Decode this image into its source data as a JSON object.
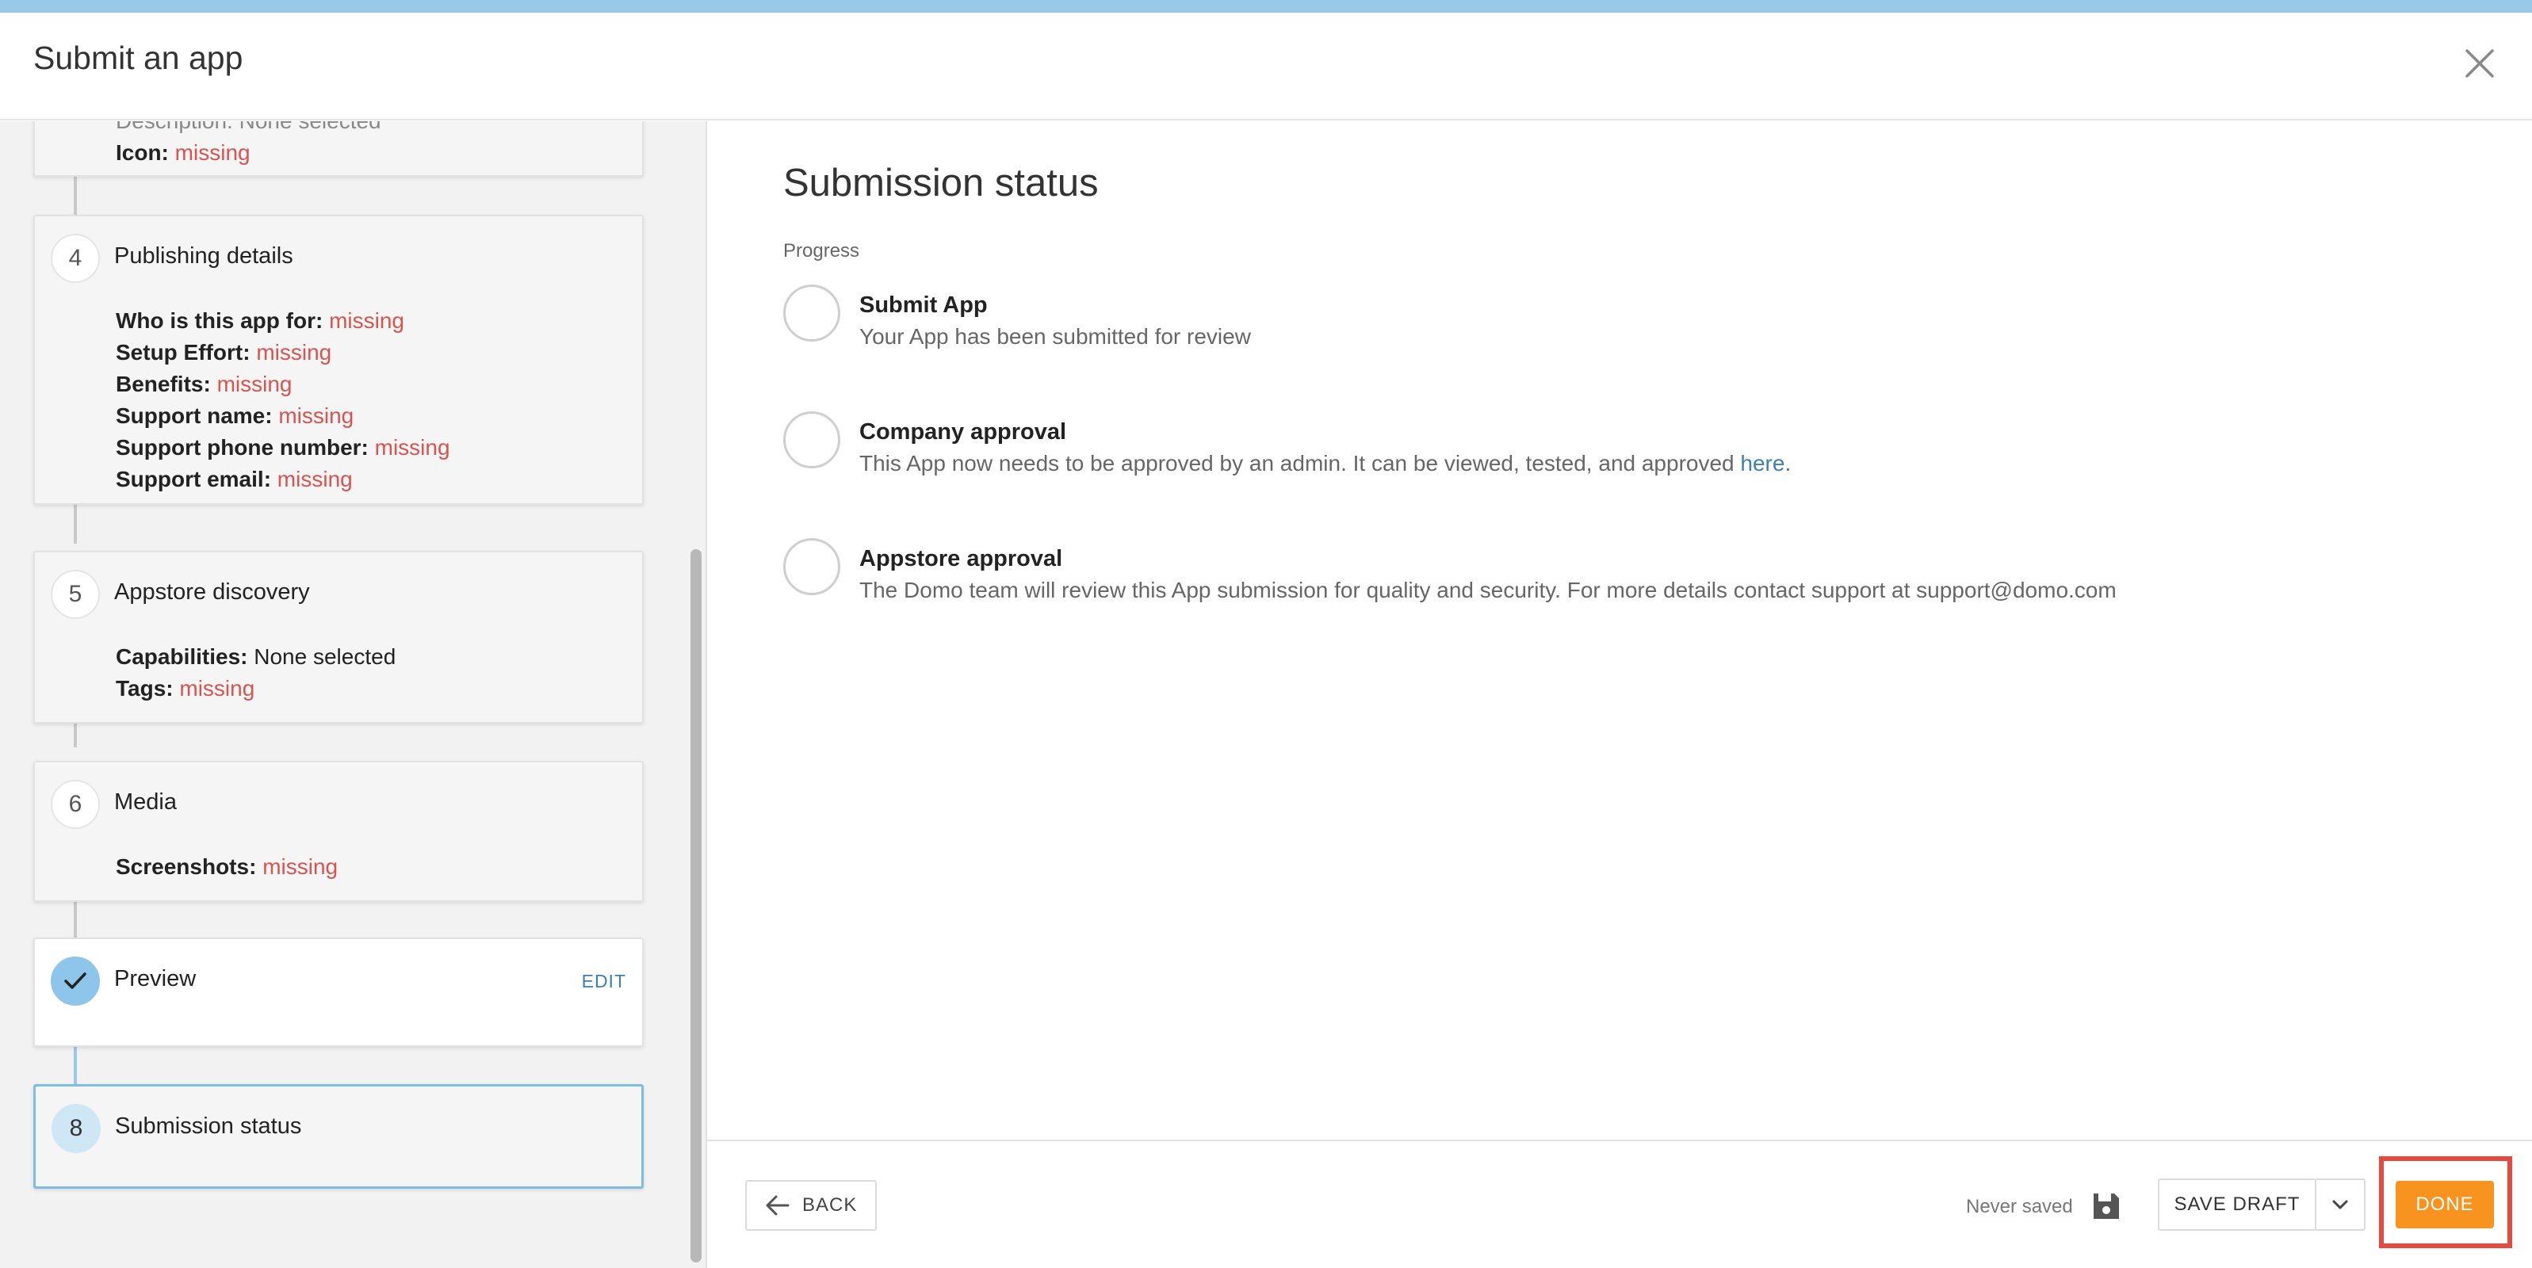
{
  "header": {
    "title": "Submit an app"
  },
  "sidebar": {
    "card3": {
      "cut_text": "Description: None selected",
      "icon_label": "Icon:",
      "icon_value": "missing"
    },
    "card4": {
      "number": "4",
      "title": "Publishing details",
      "rows": [
        {
          "label": "Who is this app for:",
          "value": "missing"
        },
        {
          "label": "Setup Effort:",
          "value": "missing"
        },
        {
          "label": "Benefits:",
          "value": "missing"
        },
        {
          "label": "Support name:",
          "value": "missing"
        },
        {
          "label": "Support phone number:",
          "value": "missing"
        },
        {
          "label": "Support email:",
          "value": "missing"
        }
      ]
    },
    "card5": {
      "number": "5",
      "title": "Appstore discovery",
      "rows": [
        {
          "label": "Capabilities:",
          "value": "None selected"
        },
        {
          "label": "Tags:",
          "value": "missing"
        }
      ]
    },
    "card6": {
      "number": "6",
      "title": "Media",
      "rows": [
        {
          "label": "Screenshots:",
          "value": "missing"
        }
      ]
    },
    "card7": {
      "title": "Preview",
      "edit": "EDIT"
    },
    "card8": {
      "number": "8",
      "title": "Submission status"
    }
  },
  "main": {
    "title": "Submission status",
    "progress_label": "Progress",
    "steps": [
      {
        "title": "Submit App",
        "desc": "Your App has been submitted for review"
      },
      {
        "title": "Company approval",
        "desc": "This App now needs to be approved by an admin. It can be viewed, tested, and approved ",
        "link": "here",
        "suffix": "."
      },
      {
        "title": "Appstore approval",
        "desc": "The Domo team will review this App submission for quality and security. For more details contact support at support@domo.com"
      }
    ]
  },
  "footer": {
    "back": "BACK",
    "never_saved": "Never saved",
    "save_draft": "SAVE DRAFT",
    "done": "DONE"
  },
  "colors": {
    "accent_blue": "#99c9e8",
    "missing_red": "#d9534f",
    "link_blue": "#3d7fb8",
    "done_orange": "#f7931e",
    "highlight_red": "#e8493f"
  },
  "icons": [
    "close-icon",
    "checkmark-icon",
    "arrow-left-icon",
    "save-disk-icon",
    "chevron-down-icon"
  ]
}
